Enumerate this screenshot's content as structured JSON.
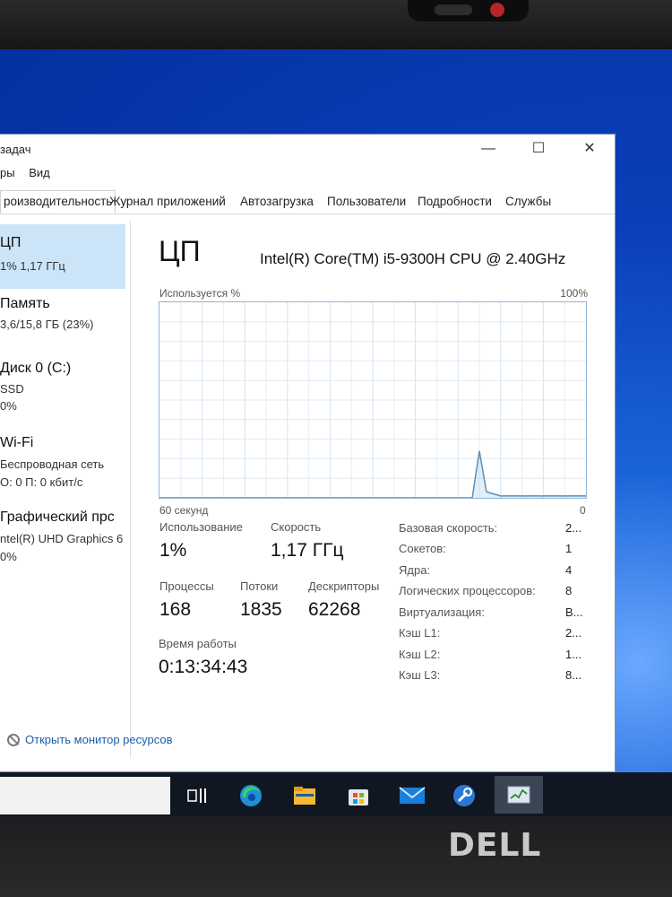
{
  "window": {
    "title": "задач",
    "menu": [
      "ры",
      "Вид"
    ],
    "tabs": [
      "роизводительность",
      "Журнал приложений",
      "Автозагрузка",
      "Пользователи",
      "Подробности",
      "Службы"
    ],
    "controls": {
      "minimize": "—",
      "maximize": "☐",
      "close": "✕"
    }
  },
  "sidebar": [
    {
      "title": "ЦП",
      "lines": [
        "1% 1,17 ГГц"
      ]
    },
    {
      "title": "Память",
      "lines": [
        "3,6/15,8 ГБ (23%)"
      ]
    },
    {
      "title": "Диск 0 (C:)",
      "lines": [
        "SSD",
        "0%"
      ]
    },
    {
      "title": "Wi-Fi",
      "lines": [
        "Беспроводная сеть",
        "О: 0 П: 0 кбит/с"
      ]
    },
    {
      "title": "Графический прс",
      "lines": [
        "ntel(R) UHD Graphics 6",
        "0%"
      ]
    }
  ],
  "cpu": {
    "title": "ЦП",
    "model": "Intel(R) Core(TM) i5-9300H CPU @ 2.40GHz",
    "graph_label": "Используется %",
    "graph_max": "100%",
    "graph_time": "60 секунд",
    "graph_min": "0"
  },
  "chart_data": {
    "type": "line",
    "ylim": [
      0,
      100
    ],
    "x": [
      0,
      1,
      2,
      3,
      4,
      5,
      6,
      7,
      8,
      9,
      10,
      11,
      12,
      13,
      14,
      15,
      16,
      17,
      18,
      19,
      20,
      21,
      22,
      23,
      24,
      25,
      26,
      27,
      28,
      29,
      30,
      31,
      32,
      33,
      34,
      35,
      36,
      37,
      38,
      39,
      40,
      41,
      42,
      43,
      44,
      45,
      46,
      47,
      48,
      49,
      50,
      51,
      52,
      53,
      54,
      55,
      56,
      57,
      58,
      59,
      60
    ],
    "values": [
      0,
      0,
      0,
      0,
      0,
      0,
      0,
      0,
      0,
      0,
      0,
      0,
      0,
      0,
      0,
      0,
      0,
      0,
      0,
      0,
      0,
      0,
      0,
      0,
      0,
      0,
      0,
      0,
      0,
      0,
      0,
      0,
      0,
      0,
      0,
      0,
      0,
      0,
      0,
      0,
      0,
      0,
      0,
      0,
      0,
      24,
      3,
      2,
      1,
      1,
      1,
      1,
      1,
      1,
      1,
      1,
      1,
      1,
      1,
      1,
      1
    ]
  },
  "stats": {
    "usage_label": "Использование",
    "usage_value": "1%",
    "speed_label": "Скорость",
    "speed_value": "1,17 ГГц",
    "processes_label": "Процессы",
    "processes_value": "168",
    "threads_label": "Потоки",
    "threads_value": "1835",
    "handles_label": "Дескрипторы",
    "handles_value": "62268",
    "uptime_label": "Время работы",
    "uptime_value": "0:13:34:43"
  },
  "specs": [
    {
      "label": "Базовая скорость:",
      "value": "2..."
    },
    {
      "label": "Сокетов:",
      "value": "1"
    },
    {
      "label": "Ядра:",
      "value": "4"
    },
    {
      "label": "Логических процессоров:",
      "value": "8"
    },
    {
      "label": "Виртуализация:",
      "value": "В..."
    },
    {
      "label": "Кэш L1:",
      "value": "2..."
    },
    {
      "label": "Кэш L2:",
      "value": "1..."
    },
    {
      "label": "Кэш L3:",
      "value": "8..."
    }
  ],
  "footer": {
    "resource_monitor": "Открыть монитор ресурсов"
  },
  "taskbar": [
    "task-view-icon",
    "edge-icon",
    "file-explorer-icon",
    "store-icon",
    "mail-icon",
    "settings-icon",
    "task-manager-icon"
  ],
  "brand": "DELL"
}
